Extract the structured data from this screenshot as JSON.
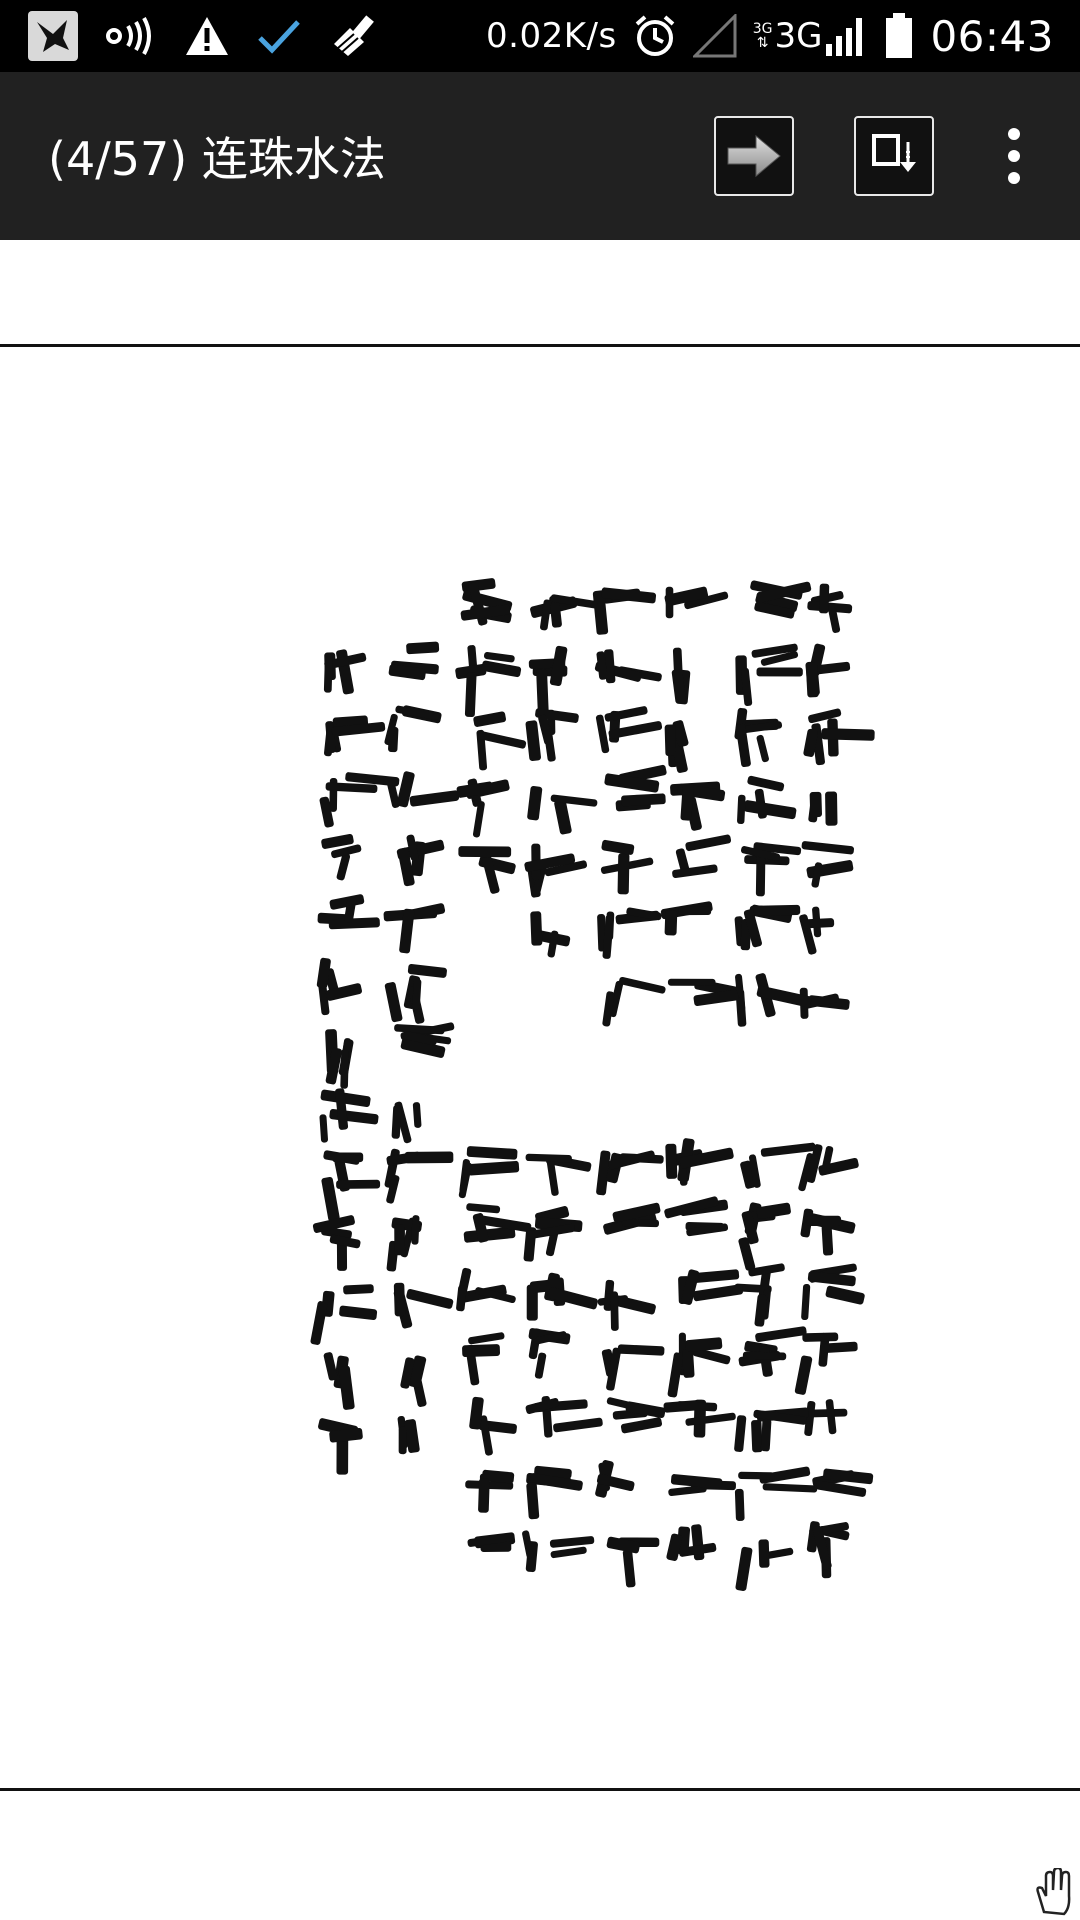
{
  "status_bar": {
    "net_speed": "0.02K/s",
    "network_small": "3G",
    "network_large": "3G",
    "time": "06:43",
    "icons": [
      "app-bird-icon",
      "nfc-wave-icon",
      "warning-icon",
      "check-icon",
      "broom-icon",
      "alarm-icon",
      "signal-empty-icon",
      "signal-full-icon",
      "battery-icon"
    ]
  },
  "action_bar": {
    "title": "(4/57) 连珠水法",
    "buttons": [
      "next-page-icon",
      "download-page-icon",
      "more-options-icon"
    ]
  },
  "document": {
    "page_number": 4,
    "total_pages": 57,
    "content": "scanned handwritten classical Chinese text page"
  },
  "cursor": {
    "icon": "hand-drag-icon"
  }
}
